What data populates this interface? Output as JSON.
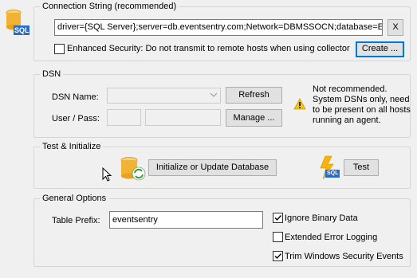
{
  "connection": {
    "title": "Connection String (recommended)",
    "value": "driver={SQL Server};server=db.eventsentry.com;Network=DBMSSOCN;database=E",
    "clear_label": "X",
    "enhanced_security": {
      "label": "Enhanced Security: Do not transmit to remote hosts when using collector",
      "checked": false
    },
    "create_label": "Create ...",
    "icon_text": "SQL"
  },
  "dsn": {
    "title": "DSN",
    "name_label": "DSN Name:",
    "user_pass_label": "User / Pass:",
    "refresh_label": "Refresh",
    "manage_label": "Manage ...",
    "warning_text": "Not recommended. System DSNs only, need to be present on all hosts running an agent."
  },
  "test_init": {
    "title": "Test & Initialize",
    "init_label": "Initialize or Update Database",
    "test_label": "Test",
    "test_icon_text": "SQL"
  },
  "general": {
    "title": "General Options",
    "table_prefix_label": "Table Prefix:",
    "table_prefix_value": "eventsentry",
    "ignore_binary": {
      "label": "Ignore Binary Data",
      "checked": true
    },
    "extended_logging": {
      "label": "Extended Error Logging",
      "checked": false
    },
    "trim_security": {
      "label": "Trim Windows Security Events",
      "checked": true
    }
  }
}
